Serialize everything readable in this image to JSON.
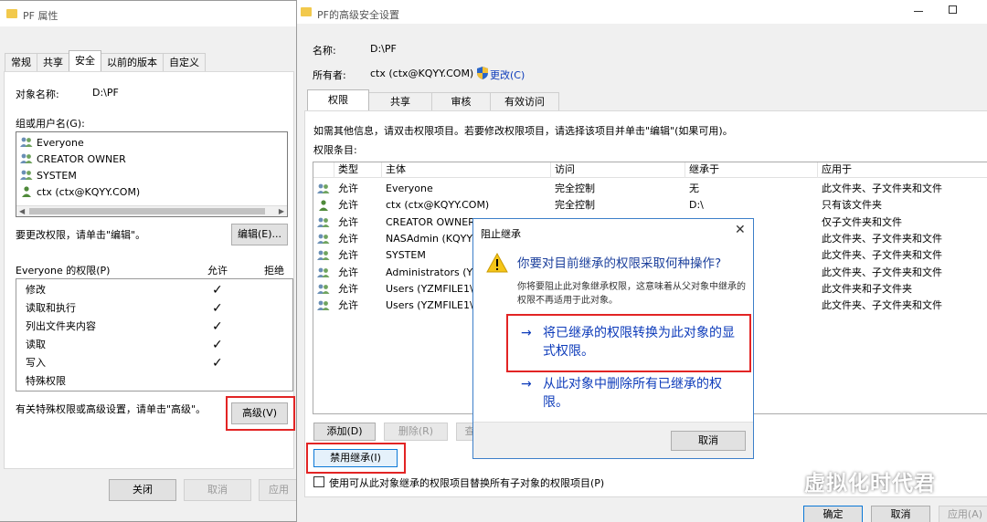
{
  "left_window": {
    "title": "PF 属性",
    "tabs": [
      "常规",
      "共享",
      "安全",
      "以前的版本",
      "自定义"
    ],
    "active_tab": 2,
    "object_label": "对象名称:",
    "object_value": "D:\\PF",
    "group_label": "组或用户名(G):",
    "groups": [
      "Everyone",
      "CREATOR OWNER",
      "SYSTEM",
      "ctx (ctx@KQYY.COM)"
    ],
    "change_hint": "要更改权限，请单击\"编辑\"。",
    "edit_button": "编辑(E)...",
    "perm_header": "Everyone 的权限(P)",
    "allow_header": "允许",
    "deny_header": "拒绝",
    "permissions": [
      {
        "name": "修改",
        "allow": "✓"
      },
      {
        "name": "读取和执行",
        "allow": "✓"
      },
      {
        "name": "列出文件夹内容",
        "allow": "✓"
      },
      {
        "name": "读取",
        "allow": "✓"
      },
      {
        "name": "写入",
        "allow": "✓"
      },
      {
        "name": "特殊权限",
        "allow": ""
      }
    ],
    "advanced_hint": "有关特殊权限或高级设置，请单击\"高级\"。",
    "advanced_button": "高级(V)",
    "close_button": "关闭",
    "cancel_button": "取消",
    "apply_button": "应用"
  },
  "right_window": {
    "title": "PF的高级安全设置",
    "name_label": "名称:",
    "name_value": "D:\\PF",
    "owner_label": "所有者:",
    "owner_value": "ctx (ctx@KQYY.COM)",
    "change_link": "更改(C)",
    "tabs": [
      "权限",
      "共享",
      "审核",
      "有效访问"
    ],
    "active_tab": 0,
    "info_text": "如需其他信息，请双击权限项目。若要修改权限项目，请选择该项目并单击\"编辑\"(如果可用)。",
    "entries_label": "权限条目:",
    "columns": [
      "类型",
      "主体",
      "访问",
      "继承于",
      "应用于"
    ],
    "rows": [
      {
        "type": "允许",
        "principal": "Everyone",
        "access": "完全控制",
        "inherited": "无",
        "applies": "此文件夹、子文件夹和文件"
      },
      {
        "type": "允许",
        "principal": "ctx (ctx@KQYY.COM)",
        "access": "完全控制",
        "inherited": "D:\\",
        "applies": "只有该文件夹"
      },
      {
        "type": "允许",
        "principal": "CREATOR OWNER",
        "access": "",
        "inherited": "",
        "applies": "仅子文件夹和文件"
      },
      {
        "type": "允许",
        "principal": "NASAdmin (KQYY\\",
        "access": "",
        "inherited": "",
        "applies": "此文件夹、子文件夹和文件"
      },
      {
        "type": "允许",
        "principal": "SYSTEM",
        "access": "",
        "inherited": "",
        "applies": "此文件夹、子文件夹和文件"
      },
      {
        "type": "允许",
        "principal": "Administrators (YZM",
        "access": "",
        "inherited": "",
        "applies": "此文件夹、子文件夹和文件"
      },
      {
        "type": "允许",
        "principal": "Users (YZMFILE1\\U",
        "access": "",
        "inherited": "",
        "applies": "此文件夹和子文件夹"
      },
      {
        "type": "允许",
        "principal": "Users (YZMFILE1\\U",
        "access": "",
        "inherited": "",
        "applies": "此文件夹、子文件夹和文件"
      }
    ],
    "add_button": "添加(D)",
    "remove_button": "删除(R)",
    "view_button": "查",
    "disable_inherit_button": "禁用继承(I)",
    "replace_checkbox": "使用可从此对象继承的权限项目替换所有子对象的权限项目(P)",
    "ok_button": "确定",
    "cancel_button": "取消",
    "apply_button": "应用(A)"
  },
  "dialog": {
    "title": "阻止继承",
    "question": "你要对目前继承的权限采取何种操作?",
    "desc": "你将要阻止此对象继承权限，这意味着从父对象中继承的权限不再适用于此对象。",
    "option1_line1": "将已继承的权限转换为此对象的显",
    "option1_line2": "式权限。",
    "option2_line1": "从此对象中删除所有已继承的权",
    "option2_line2": "限。",
    "cancel_button": "取消"
  },
  "watermark": "虚拟化时代君"
}
